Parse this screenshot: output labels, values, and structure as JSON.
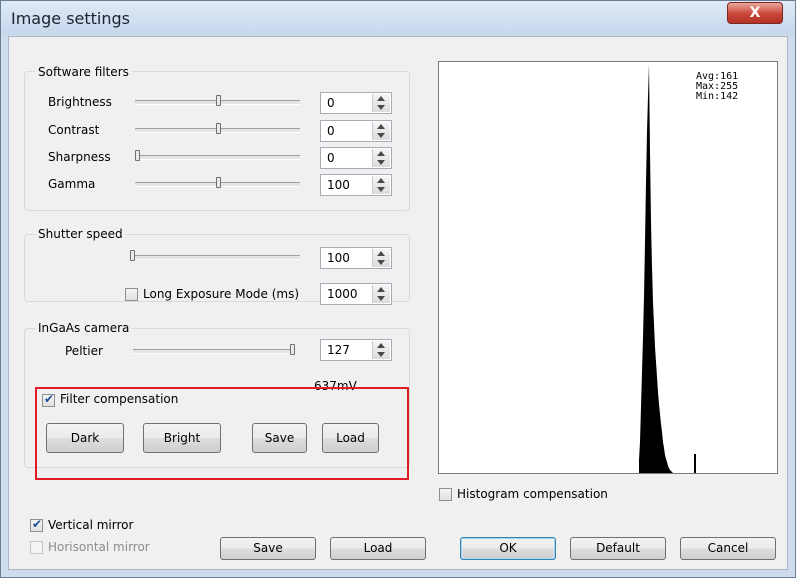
{
  "window": {
    "title": "Image settings",
    "close_label": "X"
  },
  "software_filters": {
    "title": "Software filters",
    "rows": [
      {
        "label": "Brightness",
        "value": "0",
        "level_pct": 45
      },
      {
        "label": "Contrast",
        "value": "0",
        "level_pct": 45
      },
      {
        "label": "Sharpness",
        "value": "0",
        "level_pct": 0
      },
      {
        "label": "Gamma",
        "value": "100",
        "level_pct": 45
      }
    ]
  },
  "shutter_speed": {
    "title": "Shutter speed",
    "value": "100",
    "level_pct": 0,
    "long_exposure_label": "Long Exposure Mode (ms)",
    "long_exposure_checked": false,
    "long_exposure_value": "1000"
  },
  "ingaas": {
    "title": "InGaAs camera",
    "peltier_label": "Peltier",
    "peltier_value": "127",
    "peltier_level_pct": 100,
    "voltage": "637mV"
  },
  "filter_compensation": {
    "label": "Filter compensation",
    "checked": true,
    "buttons": {
      "dark": "Dark",
      "bright": "Bright",
      "save": "Save",
      "load": "Load"
    }
  },
  "histogram": {
    "avg": "Avg:161",
    "max": "Max:255",
    "min": "Min:142",
    "compensation_label": "Histogram compensation",
    "compensation_checked": false
  },
  "mirror": {
    "vertical_label": "Vertical mirror",
    "vertical_checked": true,
    "horizontal_label": "Horisontal mirror",
    "horizontal_checked": false,
    "horizontal_enabled": false
  },
  "footer": {
    "save": "Save",
    "load": "Load",
    "ok": "OK",
    "default": "Default",
    "cancel": "Cancel"
  },
  "colors": {
    "highlight_box": "#e01b24",
    "check_mark": "#1d4d9a"
  }
}
